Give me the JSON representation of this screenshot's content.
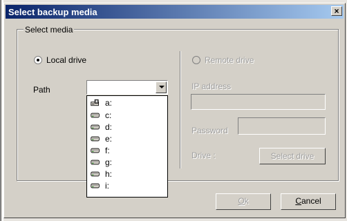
{
  "dialog": {
    "title": "Select backup media",
    "close_symbol": "×"
  },
  "group": {
    "label": "Select media"
  },
  "local": {
    "radio_label": "Local drive",
    "path_label": "Path",
    "path_value": ""
  },
  "drives": [
    {
      "label": "a:",
      "icon": "floppy-drive-icon"
    },
    {
      "label": "c:",
      "icon": "hard-drive-icon"
    },
    {
      "label": "d:",
      "icon": "hard-drive-icon"
    },
    {
      "label": "e:",
      "icon": "hard-drive-icon"
    },
    {
      "label": "f:",
      "icon": "hard-drive-icon"
    },
    {
      "label": "g:",
      "icon": "hard-drive-icon"
    },
    {
      "label": "h:",
      "icon": "hard-drive-icon"
    },
    {
      "label": "i:",
      "icon": "hard-drive-icon"
    }
  ],
  "remote": {
    "radio_label": "Remote drive",
    "ip_label": "IP address",
    "password_label": "Password",
    "drive_label": "Drive :",
    "select_drive_button": "Select drive"
  },
  "buttons": {
    "ok_first": "O",
    "ok_rest": "k",
    "cancel_first": "C",
    "cancel_rest": "ancel"
  },
  "colors": {
    "title_start": "#0a246a",
    "title_end": "#a6caf0",
    "face": "#d4d0c8",
    "disabled_text": "#a0a0a0"
  }
}
